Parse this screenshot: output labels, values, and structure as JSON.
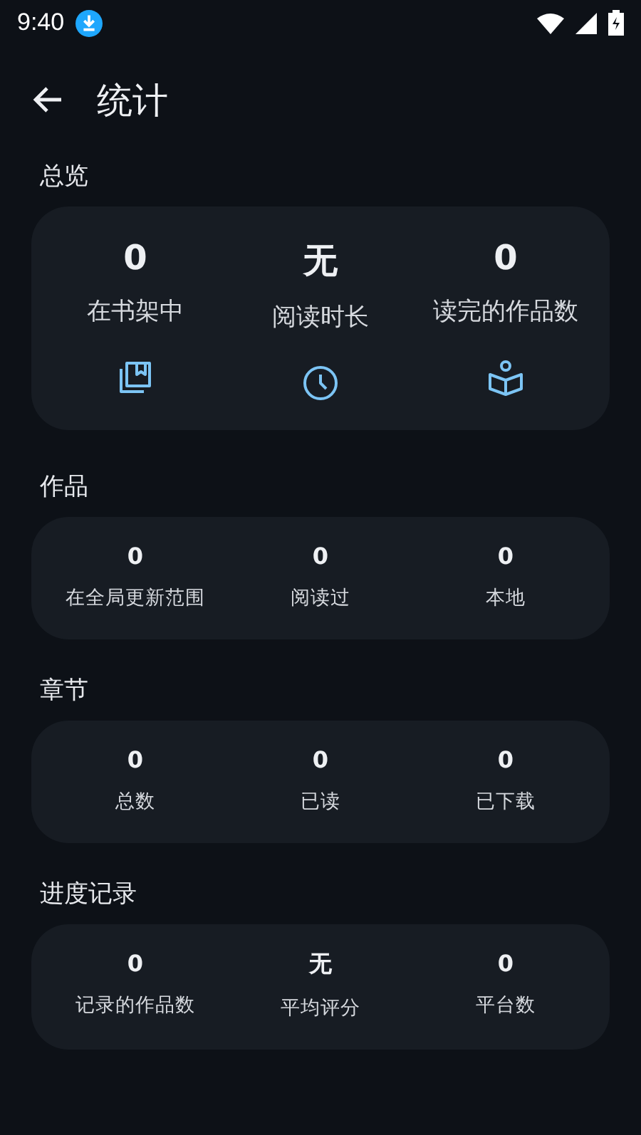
{
  "status_bar": {
    "time": "9:40"
  },
  "header": {
    "title": "统计"
  },
  "sections": [
    {
      "title": "总览",
      "kind": "large",
      "stats": [
        {
          "value": "0",
          "label": "在书架中"
        },
        {
          "value": "无",
          "label": "阅读时长"
        },
        {
          "value": "0",
          "label": "读完的作品数"
        }
      ]
    },
    {
      "title": "作品",
      "kind": "small",
      "stats": [
        {
          "value": "0",
          "label": "在全局更新范围"
        },
        {
          "value": "0",
          "label": "阅读过"
        },
        {
          "value": "0",
          "label": "本地"
        }
      ]
    },
    {
      "title": "章节",
      "kind": "small",
      "stats": [
        {
          "value": "0",
          "label": "总数"
        },
        {
          "value": "0",
          "label": "已读"
        },
        {
          "value": "0",
          "label": "已下载"
        }
      ]
    },
    {
      "title": "进度记录",
      "kind": "small",
      "stats": [
        {
          "value": "0",
          "label": "记录的作品数"
        },
        {
          "value": "无",
          "label": "平均评分"
        },
        {
          "value": "0",
          "label": "平台数"
        }
      ]
    }
  ]
}
